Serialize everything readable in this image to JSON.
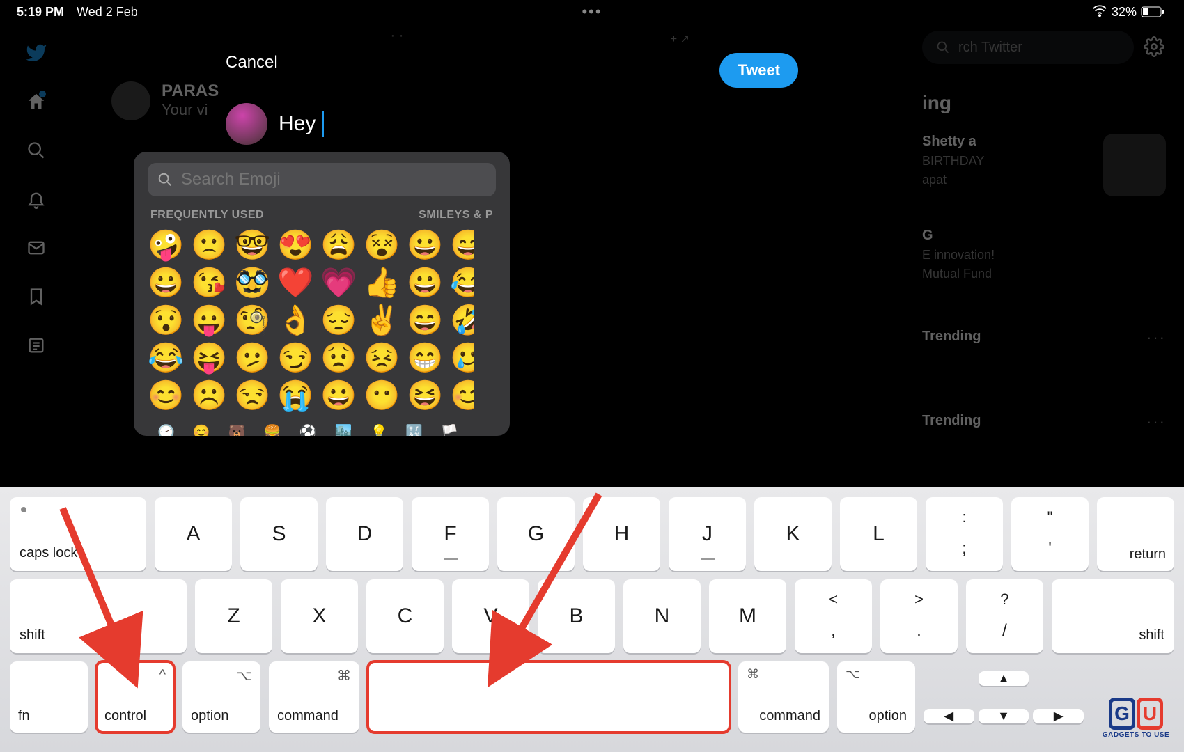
{
  "status": {
    "time": "5:19 PM",
    "date": "Wed 2 Feb",
    "battery_pct": "32%"
  },
  "twitter": {
    "search_placeholder": "rch Twitter",
    "sidebar_section": "ing",
    "feed": {
      "name": "PARAS",
      "sub": "Your vi"
    },
    "trends": [
      {
        "title": "Shetty a",
        "sub1": "BIRTHDAY",
        "sub2": "apat"
      },
      {
        "title": "G",
        "sub1": "E innovation!",
        "sub2": "Mutual Fund"
      },
      {
        "title": "Trending",
        "more": "···"
      },
      {
        "title": "Trending",
        "more": "···"
      }
    ]
  },
  "compose": {
    "cancel": "Cancel",
    "tweet": "Tweet",
    "text": "Hey"
  },
  "emoji": {
    "search_placeholder": "Search Emoji",
    "section_freq": "FREQUENTLY USED",
    "section_smileys": "SMILEYS & P",
    "grid": [
      [
        "🤪",
        "🙁",
        "🤓",
        "😍",
        "😩",
        "😵",
        "😀",
        "😅"
      ],
      [
        "😀",
        "😘",
        "🥸",
        "❤️",
        "💗",
        "👍",
        "😀",
        "😂"
      ],
      [
        "😯",
        "😛",
        "🧐",
        "👌",
        "😔",
        "✌️",
        "😄",
        "🤣"
      ],
      [
        "😂",
        "😝",
        "🫤",
        "😏",
        "😟",
        "😣",
        "😁",
        "🥲"
      ],
      [
        "😊",
        "☹️",
        "😒",
        "😭",
        "😀",
        "😶",
        "😆",
        "😊"
      ]
    ],
    "cat_icons": [
      "🕑",
      "😊",
      "🐻",
      "🍔",
      "⚽",
      "🏙️",
      "💡",
      "🔣",
      "🏳️"
    ]
  },
  "keyboard": {
    "row1_caps": "caps lock",
    "row1_letters": [
      "A",
      "S",
      "D",
      "F",
      "G",
      "H",
      "J",
      "K",
      "L"
    ],
    "row1_punct": [
      {
        "top": ":",
        "bot": ";"
      },
      {
        "top": "\"",
        "bot": "'"
      }
    ],
    "row1_return": "return",
    "row2_shift": "shift",
    "row2_letters": [
      "Z",
      "X",
      "C",
      "V",
      "B",
      "N",
      "M"
    ],
    "row2_punct": [
      {
        "top": "<",
        "bot": ","
      },
      {
        "top": ">",
        "bot": "."
      },
      {
        "top": "?",
        "bot": "/"
      }
    ],
    "row3": {
      "fn": "fn",
      "control": "control",
      "option": "option",
      "command": "command",
      "control_sym": "^",
      "option_sym": "⌥",
      "command_sym": "⌘"
    }
  },
  "watermark": "GADGETS TO USE"
}
